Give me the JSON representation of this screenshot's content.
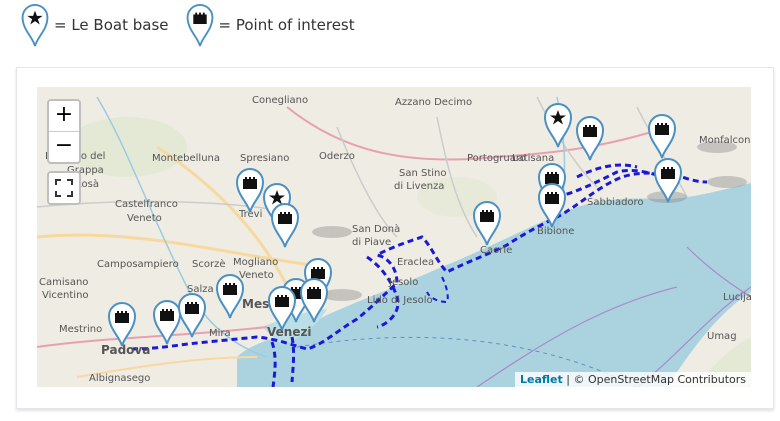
{
  "legend": {
    "base_label": "= Le Boat base",
    "poi_label": "= Point of interest"
  },
  "map": {
    "zoom_in": "+",
    "zoom_out": "−",
    "attribution_leaflet": "Leaflet",
    "attribution_rest": " | © OpenStreetMap Contributors",
    "places": [
      {
        "key": "conegliano",
        "name": "Conegliano"
      },
      {
        "key": "azzano",
        "name": "Azzano Decimo"
      },
      {
        "key": "bassano",
        "name": "Bassano del"
      },
      {
        "key": "grappa",
        "name": "Grappa"
      },
      {
        "key": "rosa",
        "name": "Rosà"
      },
      {
        "key": "montebelluna",
        "name": "Montebelluna"
      },
      {
        "key": "spresiano",
        "name": "Spresiano"
      },
      {
        "key": "oderzo",
        "name": "Oderzo"
      },
      {
        "key": "sanstino",
        "name": "San Stino"
      },
      {
        "key": "dilivenza",
        "name": "di Livenza"
      },
      {
        "key": "portogruaro",
        "name": "Portogruaro"
      },
      {
        "key": "latisana",
        "name": "Latisana"
      },
      {
        "key": "monfalcone",
        "name": "Monfalcone"
      },
      {
        "key": "castelfranco",
        "name": "Castelfranco"
      },
      {
        "key": "veneto1",
        "name": "Veneto"
      },
      {
        "key": "treviso",
        "name": "Trevi"
      },
      {
        "key": "sandona",
        "name": "San Donà"
      },
      {
        "key": "dipiave",
        "name": "di Piave"
      },
      {
        "key": "caorle",
        "name": "Caorle"
      },
      {
        "key": "sabbiadoro",
        "name": "Sabbiadoro"
      },
      {
        "key": "bibione",
        "name": "Bibione"
      },
      {
        "key": "camposampiero",
        "name": "Camposampiero"
      },
      {
        "key": "scorze",
        "name": "Scorzè"
      },
      {
        "key": "mogliano",
        "name": "Mogliano"
      },
      {
        "key": "veneto2",
        "name": "Veneto"
      },
      {
        "key": "eraclea",
        "name": "Eraclea"
      },
      {
        "key": "jesolo",
        "name": "Jesolo"
      },
      {
        "key": "lidojesolo",
        "name": "Lido di Jesolo"
      },
      {
        "key": "salzano",
        "name": "Salza"
      },
      {
        "key": "camisano",
        "name": "Camisano"
      },
      {
        "key": "vicentino",
        "name": "Vicentino"
      },
      {
        "key": "mestre",
        "name": "Mest"
      },
      {
        "key": "mira",
        "name": "Mira"
      },
      {
        "key": "venezia",
        "name": "Venezi"
      },
      {
        "key": "mestrino",
        "name": "Mestrino"
      },
      {
        "key": "padova",
        "name": "Padova"
      },
      {
        "key": "albignasego",
        "name": "Albignasego"
      },
      {
        "key": "lucija",
        "name": "Lucija"
      },
      {
        "key": "umag",
        "name": "Umag"
      }
    ]
  },
  "icon_names": {
    "base": "star-icon",
    "poi": "castle-icon"
  }
}
